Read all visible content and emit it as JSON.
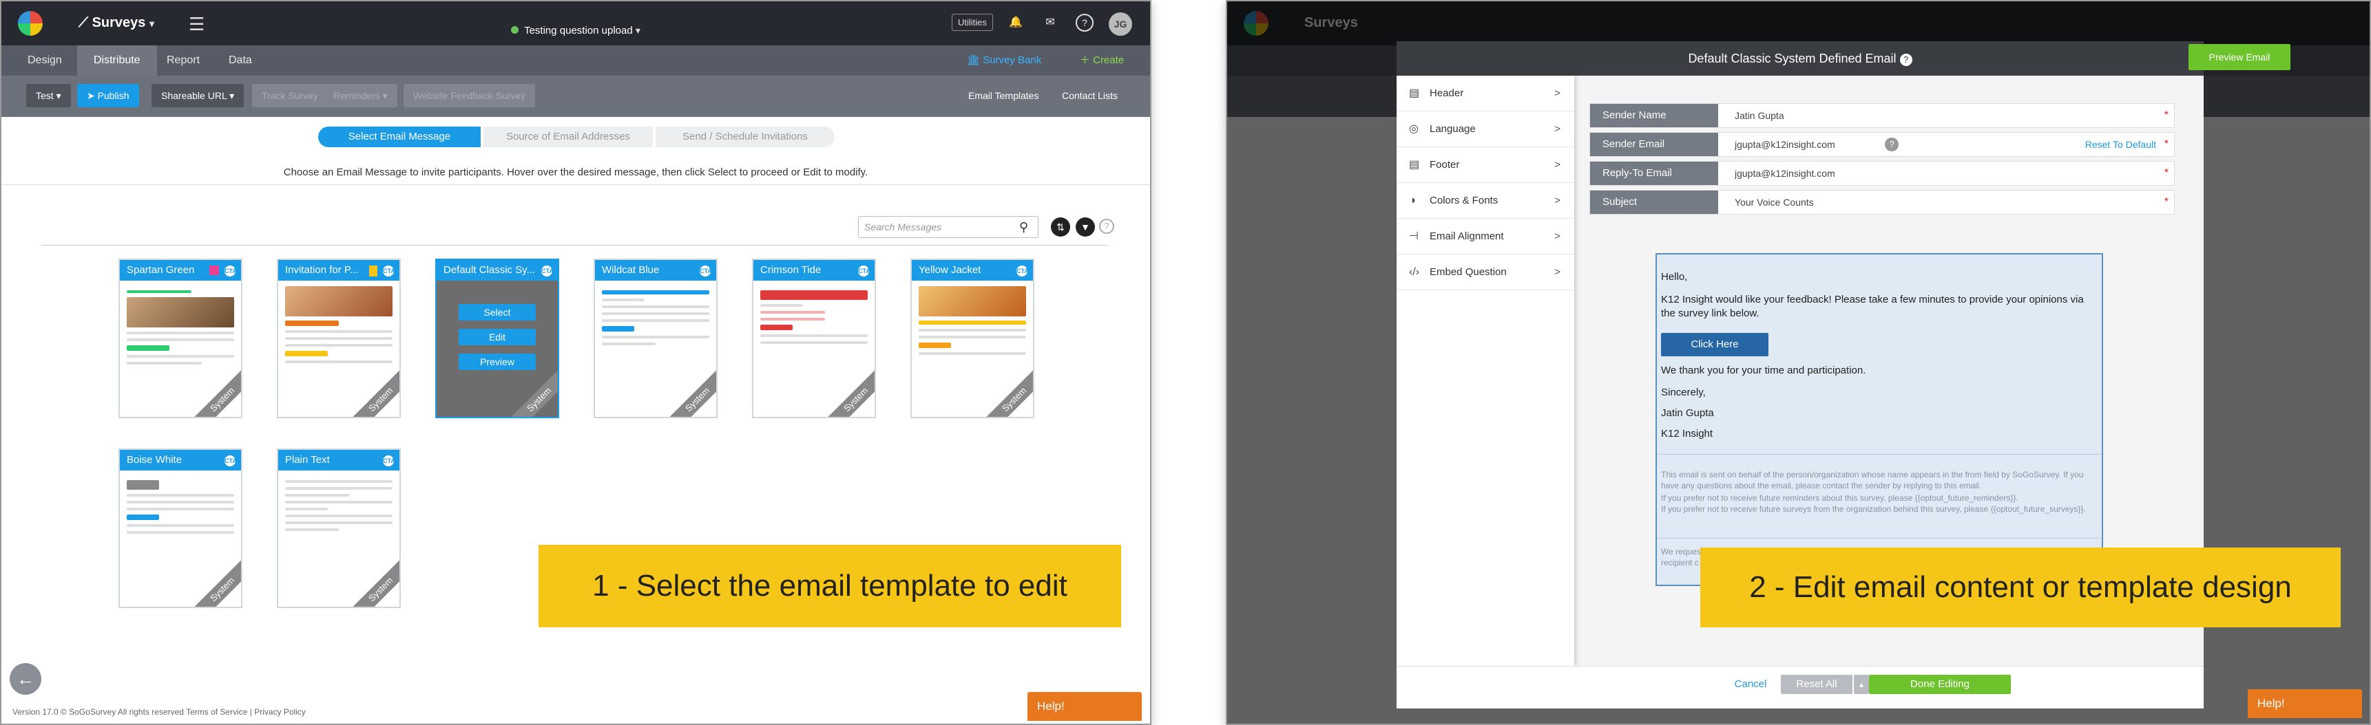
{
  "left_screen": {
    "app_switcher": "Surveys",
    "survey_name": "Testing question upload",
    "utilities": "Utilities",
    "avatar": "JG",
    "nav_tabs": [
      "Design",
      "Distribute",
      "Report",
      "Data"
    ],
    "survey_bank": "Survey Bank",
    "create": "Create",
    "toolbar": {
      "test": "Test",
      "publish": "Publish",
      "shareable_url": "Shareable URL",
      "track_survey": "Track Survey",
      "reminders": "Reminders",
      "website_feedback": "Website Feedback Survey",
      "email_templates": "Email Templates",
      "contact_lists": "Contact Lists"
    },
    "steps": [
      "Select Email Message",
      "Source of Email Addresses",
      "Send / Schedule Invitations"
    ],
    "instruction": "Choose an Email Message to invite participants. Hover over the desired message, then click Select to proceed or Edit to modify.",
    "search_placeholder": "Search Messages",
    "templates": [
      {
        "name": "Spartan Green",
        "badge": "CTA"
      },
      {
        "name": "Invitation for P...",
        "badge": "CTA"
      },
      {
        "name": "Default Classic Sy...",
        "badge": "CTA"
      },
      {
        "name": "Wildcat Blue",
        "badge": "CTA"
      },
      {
        "name": "Crimson Tide",
        "badge": "CTA"
      },
      {
        "name": "Yellow Jacket",
        "badge": "CTA"
      },
      {
        "name": "Boise White",
        "badge": "CTA"
      },
      {
        "name": "Plain Text",
        "badge": "CTA"
      }
    ],
    "ribbon": "System",
    "hover_actions": [
      "Select",
      "Edit",
      "Preview"
    ],
    "callout": "1 - Select the email template to edit",
    "footer": "Version 17.0 © SoGoSurvey    All rights reserved    Terms of Service | Privacy Policy",
    "help": "Help!"
  },
  "right_screen": {
    "modal_title": "Default Classic System Defined Email",
    "preview_email": "Preview Email",
    "sidebar": [
      "Header",
      "Language",
      "Footer",
      "Colors & Fonts",
      "Email Alignment",
      "Embed Question"
    ],
    "fields": [
      {
        "label": "Sender Name",
        "value": "Jatin Gupta"
      },
      {
        "label": "Sender Email",
        "value": "jgupta@k12insight.com"
      },
      {
        "label": "Reply-To Email",
        "value": "jgupta@k12insight.com"
      },
      {
        "label": "Subject",
        "value": "Your Voice Counts"
      }
    ],
    "reset_to_default": "Reset To Default",
    "email": {
      "greeting": "Hello,",
      "intro": "K12 Insight would like your feedback! Please take a few minutes to provide your opinions via the survey link below.",
      "button": "Click Here",
      "thanks": "We thank you for your time and participation.",
      "closing": "Sincerely,",
      "name": "Jatin Gupta",
      "org": "K12 Insight",
      "disclaimer1": "This email is sent on behalf of the person/organization whose name appears in the from field by SoGoSurvey. If you have any questions about the email, please contact the sender by replying to this email.",
      "disclaimer2": "If you prefer not to receive future reminders about this survey, please {{optout_future_reminders}}.",
      "disclaimer3": "If you prefer not to receive future surveys from the organization behind this survey, please {{optout_future_surveys}}.",
      "trail1": "We request",
      "trail2": "recipient c"
    },
    "cancel": "Cancel",
    "reset_all": "Reset All",
    "done_editing": "Done Editing",
    "callout": "2 - Edit email content or template design",
    "help": "Help!"
  },
  "colors": {
    "accent": "#1a9be6",
    "callout": "#f5c518",
    "help": "#e8781e",
    "done": "#6dc32c"
  }
}
